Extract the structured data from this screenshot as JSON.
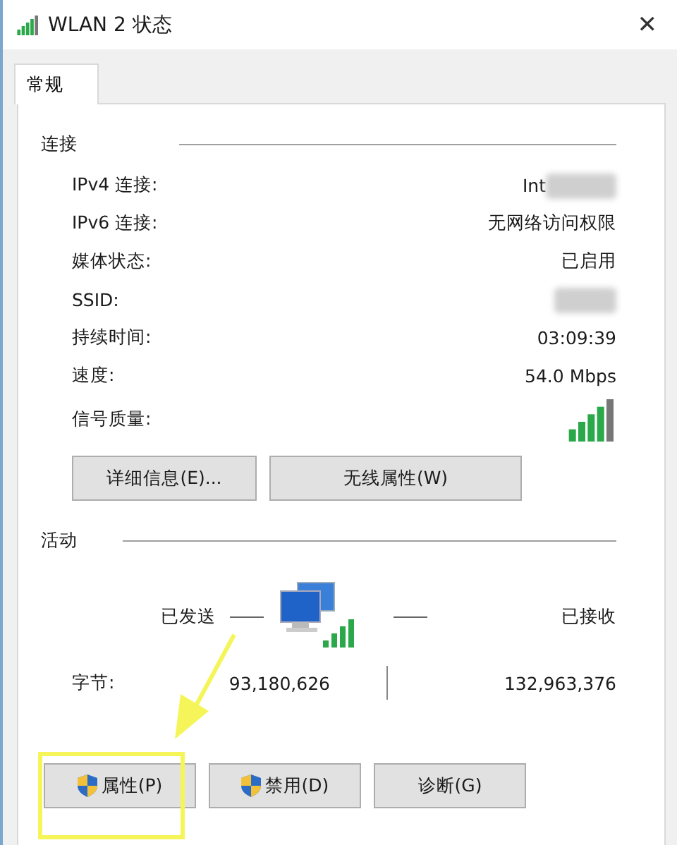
{
  "window": {
    "title": "WLAN 2 状态",
    "close": "✕"
  },
  "tabs": [
    {
      "label": "常规",
      "selected": true
    }
  ],
  "connection": {
    "heading": "连接",
    "rows": [
      {
        "label": "IPv4 连接:",
        "kind": "text",
        "value": "Int",
        "redacted": true
      },
      {
        "label": "IPv6 连接:",
        "kind": "text",
        "value": "无网络访问权限",
        "redacted": false
      },
      {
        "label": "媒体状态:",
        "kind": "text",
        "value": "已启用",
        "redacted": false
      },
      {
        "label": "SSID:",
        "kind": "redacted"
      },
      {
        "label": "持续时间:",
        "kind": "text",
        "value": "03:09:39",
        "redacted": false
      },
      {
        "label": "速度:",
        "kind": "text",
        "value": "54.0 Mbps",
        "redacted": false
      },
      {
        "label": "信号质量:",
        "kind": "signal"
      }
    ],
    "buttons": [
      "详细信息(E)...",
      "无线属性(W)"
    ]
  },
  "activity": {
    "heading": "活动",
    "sent": "已发送",
    "received": "已接收",
    "bytes_label": "字节:",
    "bytes_sent": "93,180,626",
    "bytes_received": "132,963,376"
  },
  "buttons": [
    {
      "label": "属性(P)",
      "shield": true,
      "highlighted": true
    },
    {
      "label": "禁用(D)",
      "shield": true,
      "highlighted": false
    },
    {
      "label": "诊断(G)",
      "shield": false,
      "highlighted": false
    }
  ]
}
